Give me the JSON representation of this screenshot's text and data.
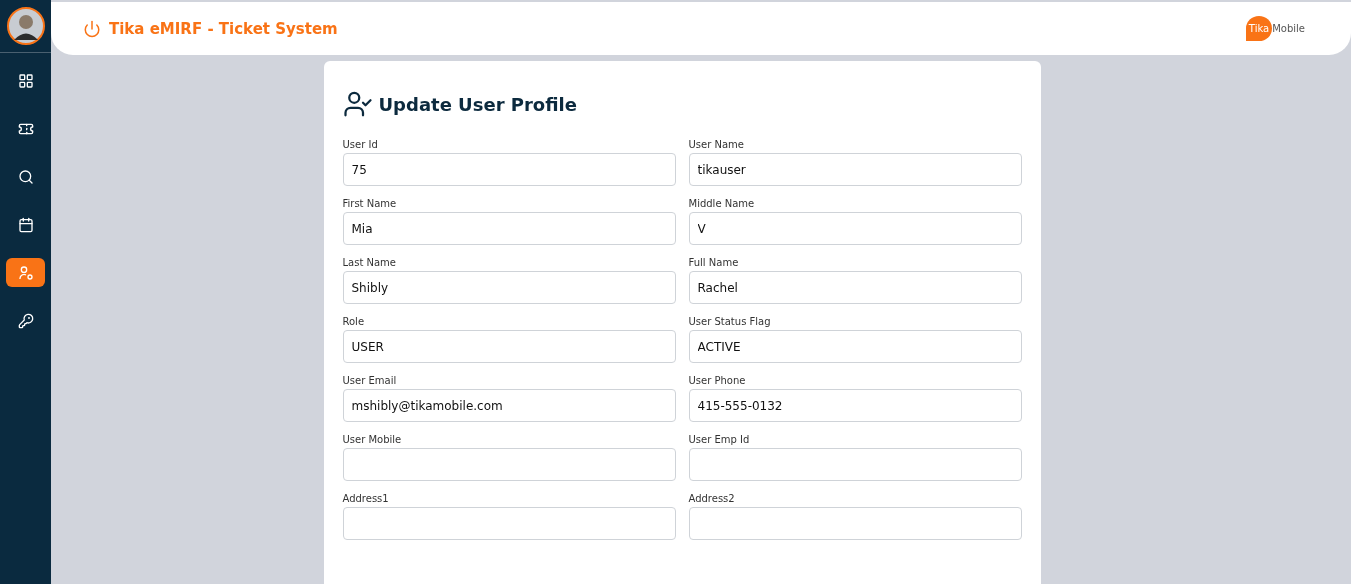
{
  "sidebar": {
    "items": [
      {
        "selected": false
      },
      {
        "selected": false
      },
      {
        "selected": false
      },
      {
        "selected": false
      },
      {
        "selected": true
      },
      {
        "selected": false
      }
    ]
  },
  "header": {
    "title": "Tika eMIRF - Ticket System",
    "logo": {
      "mark": "Tika",
      "word": "Mobile"
    }
  },
  "form": {
    "title": "Update User Profile",
    "fields": [
      {
        "label": "User Id",
        "value": "75"
      },
      {
        "label": "User Name",
        "value": "tikauser"
      },
      {
        "label": "First Name",
        "value": "Mia"
      },
      {
        "label": "Middle Name",
        "value": "V"
      },
      {
        "label": "Last Name",
        "value": "Shibly"
      },
      {
        "label": "Full Name",
        "value": "Rachel"
      },
      {
        "label": "Role",
        "value": "USER"
      },
      {
        "label": "User Status Flag",
        "value": "ACTIVE"
      },
      {
        "label": "User Email",
        "value": "mshibly@tikamobile.com"
      },
      {
        "label": "User Phone",
        "value": "415-555-0132"
      },
      {
        "label": "User Mobile"
      },
      {
        "label": "User Emp Id"
      },
      {
        "label": "Address1"
      },
      {
        "label": "Address2"
      }
    ]
  }
}
